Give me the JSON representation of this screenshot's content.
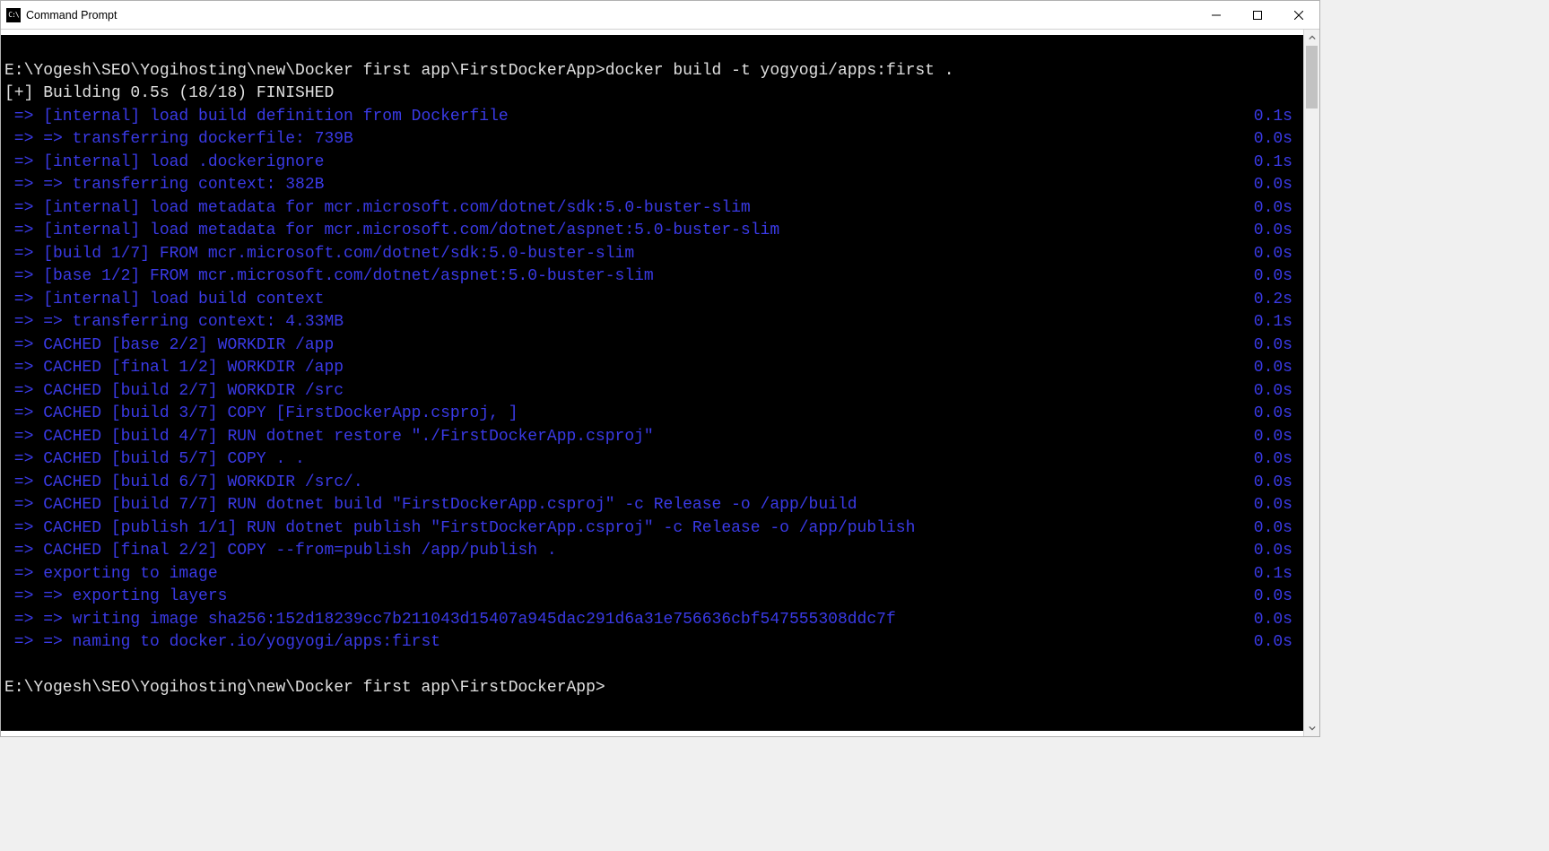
{
  "window": {
    "title": "Command Prompt",
    "icon_label": "cmd-icon"
  },
  "terminal": {
    "prompt1_path": "E:\\Yogesh\\SEO\\Yogihosting\\new\\Docker first app\\FirstDockerApp>",
    "prompt1_cmd": "docker build -t yogyogi/apps:first .",
    "building_line": "[+] Building 0.5s (18/18) FINISHED",
    "steps": [
      {
        "text": " => [internal] load build definition from Dockerfile",
        "time": "0.1s"
      },
      {
        "text": " => => transferring dockerfile: 739B",
        "time": "0.0s"
      },
      {
        "text": " => [internal] load .dockerignore",
        "time": "0.1s"
      },
      {
        "text": " => => transferring context: 382B",
        "time": "0.0s"
      },
      {
        "text": " => [internal] load metadata for mcr.microsoft.com/dotnet/sdk:5.0-buster-slim",
        "time": "0.0s"
      },
      {
        "text": " => [internal] load metadata for mcr.microsoft.com/dotnet/aspnet:5.0-buster-slim",
        "time": "0.0s"
      },
      {
        "text": " => [build 1/7] FROM mcr.microsoft.com/dotnet/sdk:5.0-buster-slim",
        "time": "0.0s"
      },
      {
        "text": " => [base 1/2] FROM mcr.microsoft.com/dotnet/aspnet:5.0-buster-slim",
        "time": "0.0s"
      },
      {
        "text": " => [internal] load build context",
        "time": "0.2s"
      },
      {
        "text": " => => transferring context: 4.33MB",
        "time": "0.1s"
      },
      {
        "text": " => CACHED [base 2/2] WORKDIR /app",
        "time": "0.0s"
      },
      {
        "text": " => CACHED [final 1/2] WORKDIR /app",
        "time": "0.0s"
      },
      {
        "text": " => CACHED [build 2/7] WORKDIR /src",
        "time": "0.0s"
      },
      {
        "text": " => CACHED [build 3/7] COPY [FirstDockerApp.csproj, ]",
        "time": "0.0s"
      },
      {
        "text": " => CACHED [build 4/7] RUN dotnet restore \"./FirstDockerApp.csproj\"",
        "time": "0.0s"
      },
      {
        "text": " => CACHED [build 5/7] COPY . .",
        "time": "0.0s"
      },
      {
        "text": " => CACHED [build 6/7] WORKDIR /src/.",
        "time": "0.0s"
      },
      {
        "text": " => CACHED [build 7/7] RUN dotnet build \"FirstDockerApp.csproj\" -c Release -o /app/build",
        "time": "0.0s"
      },
      {
        "text": " => CACHED [publish 1/1] RUN dotnet publish \"FirstDockerApp.csproj\" -c Release -o /app/publish",
        "time": "0.0s"
      },
      {
        "text": " => CACHED [final 2/2] COPY --from=publish /app/publish .",
        "time": "0.0s"
      },
      {
        "text": " => exporting to image",
        "time": "0.1s"
      },
      {
        "text": " => => exporting layers",
        "time": "0.0s"
      },
      {
        "text": " => => writing image sha256:152d18239cc7b211043d15407a945dac291d6a31e756636cbf547555308ddc7f",
        "time": "0.0s"
      },
      {
        "text": " => => naming to docker.io/yogyogi/apps:first",
        "time": "0.0s"
      }
    ],
    "prompt2_path": "E:\\Yogesh\\SEO\\Yogihosting\\new\\Docker first app\\FirstDockerApp>"
  }
}
